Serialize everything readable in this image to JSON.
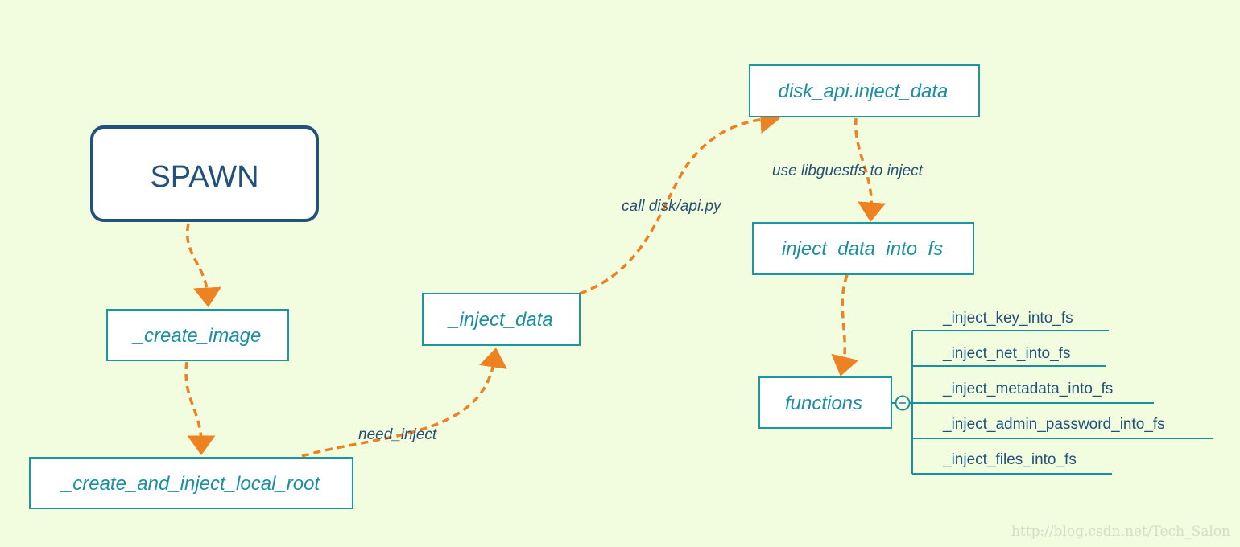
{
  "colors": {
    "background": "#f2fde0",
    "node_border": "#1a97a0",
    "node_text": "#1a8fa0",
    "root_border": "#22527a",
    "edge": "#ee8122",
    "edge_label": "#274f74"
  },
  "root": {
    "label": "SPAWN"
  },
  "nodes": {
    "create_image": "_create_image",
    "create_and_inject_local_root": "_create_and_inject_local_root",
    "inject_data": "_inject_data",
    "disk_api_inject_data": "disk_api.inject_data",
    "inject_data_into_fs": "inject_data_into_fs",
    "functions": "functions"
  },
  "edge_labels": {
    "need_inject": "need_inject",
    "call_disk_api": "call disk/api.py",
    "use_libguestfs": "use libguestfs to inject"
  },
  "functions_children": [
    "_inject_key_into_fs",
    "_inject_net_into_fs",
    "_inject_metadata_into_fs",
    "_inject_admin_password_into_fs",
    "_inject_files_into_fs"
  ],
  "collapse_icon": "minus-circle-icon",
  "watermark": "http://blog.csdn.net/Tech_Salon"
}
